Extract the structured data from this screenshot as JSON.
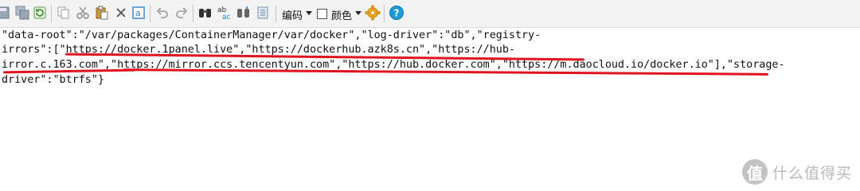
{
  "toolbar": {
    "icons": [
      "save-icon",
      "save-all-icon",
      "reload-icon",
      "copy-icon",
      "cut-icon",
      "paste-icon",
      "delete-icon",
      "select-all-icon",
      "undo-icon",
      "redo-icon",
      "find-icon",
      "replace-icon",
      "goto-icon",
      "bookmark-icon"
    ],
    "encoding_label": "编码",
    "color_label": "颜色",
    "settings_icon": "gear-icon",
    "help_icon": "help-icon"
  },
  "editor": {
    "lines": [
      "\"data-root\":\"/var/packages/ContainerManager/var/docker\",\"log-driver\":\"db\",\"registry-",
      "irrors\":[\"https://docker.1panel.live\",\"https://dockerhub.azk8s.cn\",\"https://hub-",
      "irror.c.163.com\",\"https://mirror.ccs.tencentyun.com\",\"https://hub.docker.com\",\"https://m.daocloud.io/docker.io\"],\"storage-",
      "driver\":\"btrfs\"}"
    ]
  },
  "watermark": {
    "logo_char": "值",
    "text": "什么值得买"
  },
  "colors": {
    "underline": "#e0141f",
    "toolbar_bg": "#f3f3f3"
  }
}
